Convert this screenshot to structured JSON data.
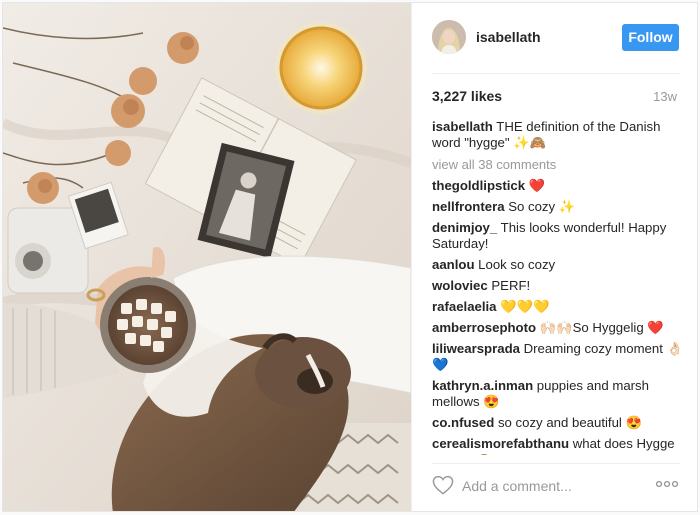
{
  "post": {
    "username": "isabellath",
    "follow_label": "Follow",
    "likes": "3,227 likes",
    "time_ago": "13w",
    "caption_user": "isabellath",
    "caption_text": " THE definition of the Danish word \"hygge\" ✨🙈",
    "view_all": "view all 38 comments"
  },
  "comments": [
    {
      "user": "thegoldlipstick",
      "text": " ❤️"
    },
    {
      "user": "nellfrontera",
      "text": " So cozy ✨"
    },
    {
      "user": "denimjoy_",
      "text": " This looks wonderful! Happy Saturday!"
    },
    {
      "user": "aanlou",
      "text": " Look so cozy"
    },
    {
      "user": "woloviec",
      "text": " PERF!"
    },
    {
      "user": "rafaelaelia",
      "text": " 💛💛💛"
    },
    {
      "user": "amberrosephoto",
      "text": " 🙌🏻🙌🏻So Hyggelig ❤️"
    },
    {
      "user": "liliwearsprada",
      "text": " Dreaming cozy moment 👌🏻💙"
    },
    {
      "user": "kathryn.a.inman",
      "text": " puppies and marsh mellows 😍"
    },
    {
      "user": "co.nfused",
      "text": " so cozy and beautiful 😍"
    },
    {
      "user": "cerealismorefabthanu",
      "text": " what does Hygge mean? 🙈"
    }
  ],
  "footer": {
    "comment_placeholder": "Add a comment..."
  },
  "icons": {
    "like": "heart-outline-icon",
    "more": "more-options-icon"
  },
  "colors": {
    "follow_button": "#3897f0",
    "muted_text": "#999999"
  }
}
